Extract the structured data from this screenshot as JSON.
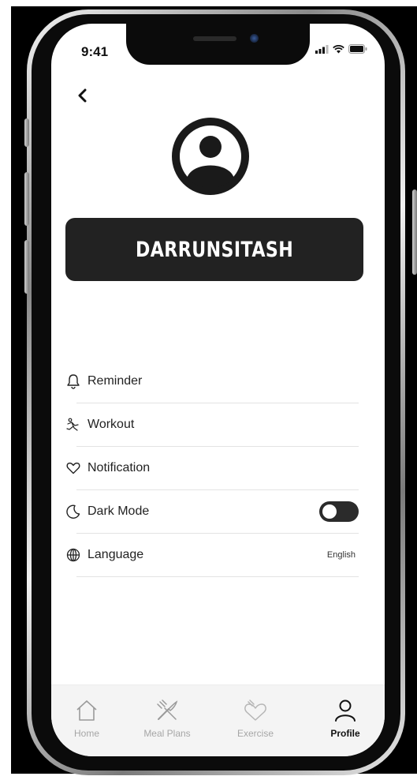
{
  "status_bar": {
    "time": "9:41"
  },
  "profile": {
    "username": "DARRUNSITASH"
  },
  "menu": [
    {
      "label": "Reminder",
      "icon": "bell-icon"
    },
    {
      "label": "Workout",
      "icon": "running-icon"
    },
    {
      "label": "Notification",
      "icon": "heart-icon"
    },
    {
      "label": "Dark Mode",
      "icon": "moon-icon",
      "toggle": "off"
    },
    {
      "label": "Language",
      "icon": "globe-icon",
      "value": "English"
    }
  ],
  "tabs": [
    {
      "label": "Home",
      "icon": "home-icon"
    },
    {
      "label": "Meal Plans",
      "icon": "utensils-icon"
    },
    {
      "label": "Exercise",
      "icon": "exercise-icon"
    },
    {
      "label": "Profile",
      "icon": "user-icon",
      "active": true
    }
  ]
}
